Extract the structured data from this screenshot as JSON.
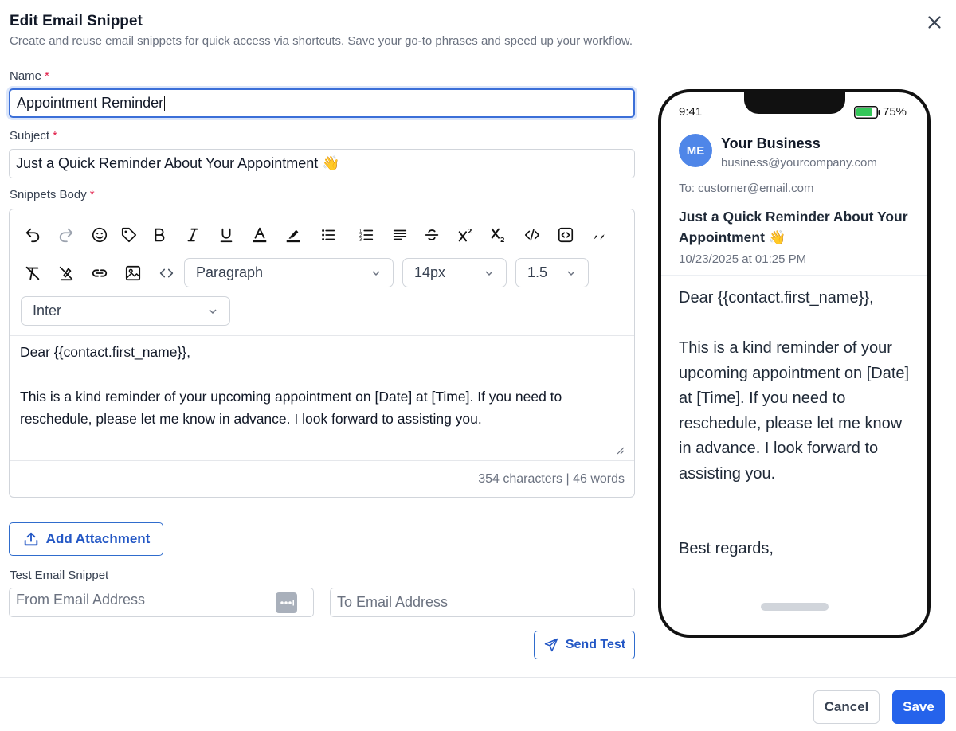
{
  "dialog": {
    "title": "Edit Email Snippet",
    "subtitle": "Create and reuse email snippets for quick access via shortcuts. Save your go-to phrases and speed up your workflow.",
    "close_icon": "close-icon"
  },
  "form": {
    "name_label": "Name",
    "name_value": "Appointment Reminder",
    "subject_label": "Subject",
    "subject_value": "Just a Quick Reminder About Your Appointment 👋",
    "body_label": "Snippets Body",
    "required_mark": "*"
  },
  "editor": {
    "toolbar_icons": [
      "undo-icon",
      "redo-icon",
      "emoji-icon",
      "tag-icon",
      "bold-icon",
      "italic-icon",
      "underline-icon",
      "text-color-icon",
      "highlight-icon",
      "bullet-list-icon",
      "numbered-list-icon",
      "align-icon",
      "strikethrough-icon",
      "superscript-icon",
      "subscript-icon",
      "code-icon",
      "code-block-icon",
      "quote-icon",
      "clear-format-icon",
      "clear-highlight-icon",
      "link-icon",
      "image-icon",
      "source-code-icon"
    ],
    "block_format": "Paragraph",
    "font_size": "14px",
    "line_height": "1.5",
    "font_family": "Inter",
    "body_line1": "Dear {{contact.first_name}},",
    "body_line2": "This is a kind reminder of your upcoming appointment on [Date] at [Time]. If you need to reschedule, please let me know in advance. I look forward to assisting you.",
    "counter": "354 characters | 46 words"
  },
  "attachment": {
    "button_label": "Add Attachment"
  },
  "test": {
    "label": "Test Email Snippet",
    "from_placeholder": "From Email Address",
    "to_placeholder": "To Email Address",
    "send_label": "Send Test"
  },
  "footer": {
    "cancel_label": "Cancel",
    "save_label": "Save"
  },
  "preview": {
    "time": "9:41",
    "battery": "75%",
    "avatar_initials": "ME",
    "sender_name": "Your Business",
    "sender_email": "business@yourcompany.com",
    "to_line": "To: customer@email.com",
    "subject": "Just a Quick Reminder About Your Appointment 👋",
    "date": "10/23/2025 at 01:25 PM",
    "greeting": "Dear {{contact.first_name}},",
    "paragraph": "This is a kind reminder of your upcoming appointment on [Date] at [Time]. If you need to reschedule, please let me know in advance. I look forward to assisting you.",
    "signoff": "Best regards,"
  },
  "colors": {
    "accent": "#2563eb",
    "focus_border": "#3b6fd8",
    "required": "#e11d48"
  }
}
